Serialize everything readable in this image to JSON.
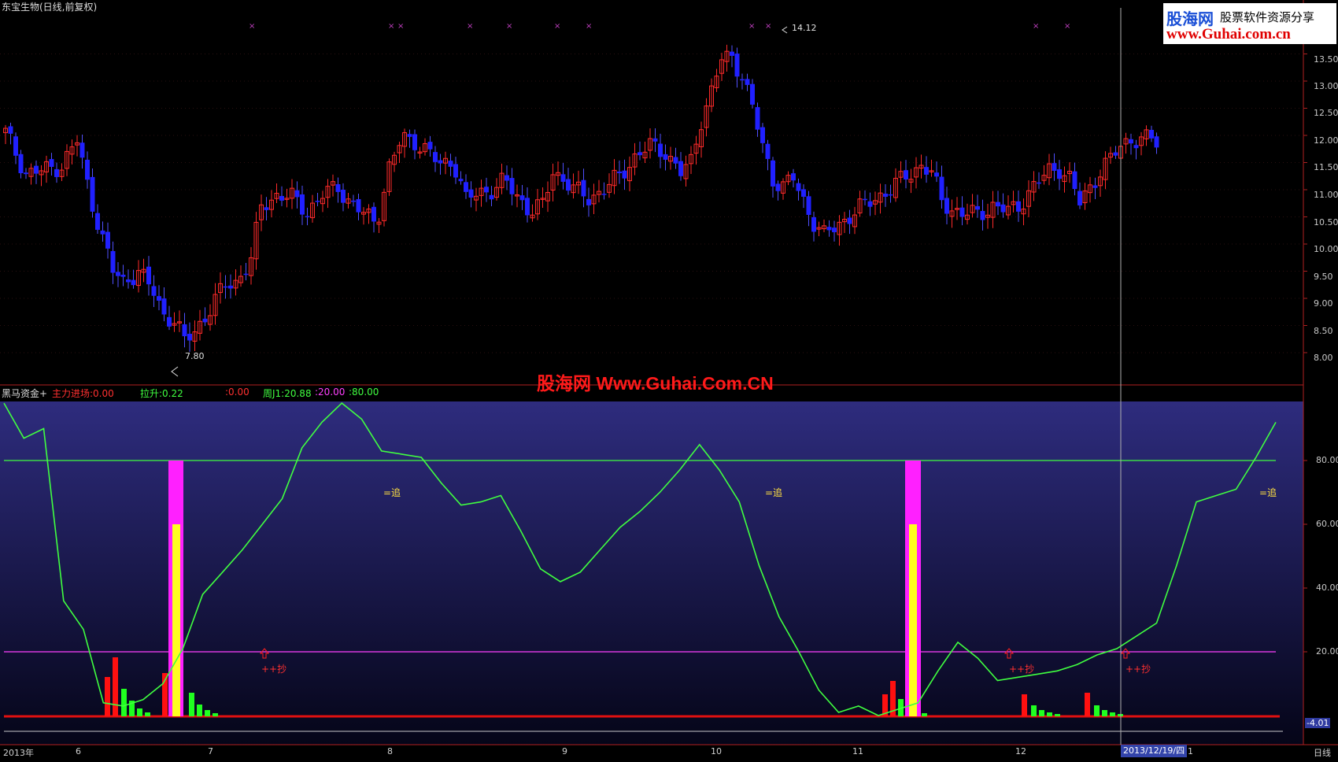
{
  "window": {
    "title": "东宝生物(日线,前复权)",
    "period_label": "日线"
  },
  "logo": {
    "brand": "股海网",
    "slogan": "股票软件资源分享",
    "url": "www.Guhai.com.cn"
  },
  "watermark": "股海网 Www.Guhai.Com.CN",
  "price_chart": {
    "high_label": "14.12",
    "low_label": "7.80",
    "y_ticks": [
      "13.50",
      "13.00",
      "12.50",
      "12.00",
      "11.50",
      "11.00",
      "10.50",
      "10.00",
      "9.50",
      "9.00",
      "8.50",
      "8.00"
    ]
  },
  "indicator": {
    "name": "黑马资金+",
    "fields": [
      {
        "label": "主力进场:",
        "value": "0.00",
        "color": "#ff3030"
      },
      {
        "label": "拉升:",
        "value": "0.22",
        "color": "#40ff40"
      },
      {
        "label": ":",
        "value": "0.00",
        "color": "#ff3030"
      },
      {
        "label": "周J1:",
        "value": "20.88",
        "color": "#40ff40"
      },
      {
        "label": ":",
        "value": "20.00",
        "color": "#ff40ff"
      },
      {
        "label": ":",
        "value": "80.00",
        "color": "#40ff40"
      }
    ],
    "y_ticks": [
      "80.00",
      "60.00",
      "40.00",
      "20.00"
    ],
    "current_value": "-4.01",
    "signals": [
      {
        "type": "chase",
        "text": "=追"
      },
      {
        "type": "chase",
        "text": "=追"
      },
      {
        "type": "chase",
        "text": "=追"
      },
      {
        "type": "buy",
        "text": "++抄"
      },
      {
        "type": "buy",
        "text": "++抄"
      },
      {
        "type": "buy",
        "text": "++抄"
      }
    ],
    "j1_curve": [
      98,
      87,
      90,
      36,
      27,
      4,
      3,
      5,
      10,
      21,
      38,
      45,
      52,
      60,
      68,
      84,
      92,
      98,
      93,
      83,
      82,
      81,
      73,
      66,
      67,
      69,
      58,
      46,
      42,
      45,
      52,
      59,
      64,
      70,
      77,
      85,
      77,
      67,
      47,
      31,
      20,
      8,
      1,
      3,
      0,
      2,
      4,
      14,
      23,
      18,
      11,
      12,
      13,
      14,
      16,
      19,
      21,
      25,
      29,
      47,
      67,
      69,
      71,
      81,
      92
    ]
  },
  "time_axis": {
    "labels": [
      "2013年",
      "6",
      "7",
      "8",
      "9",
      "10",
      "11",
      "12",
      "1"
    ],
    "cursor_date": "2013/12/19/四"
  },
  "colors": {
    "up": "#ff2a2a",
    "down": "#2020ff",
    "j1_line": "#40ff40",
    "line_80": "#40ff40",
    "line_20": "#ff40ff",
    "pink_bar": "#ff20ff",
    "yellow_bar": "#ffff20"
  }
}
